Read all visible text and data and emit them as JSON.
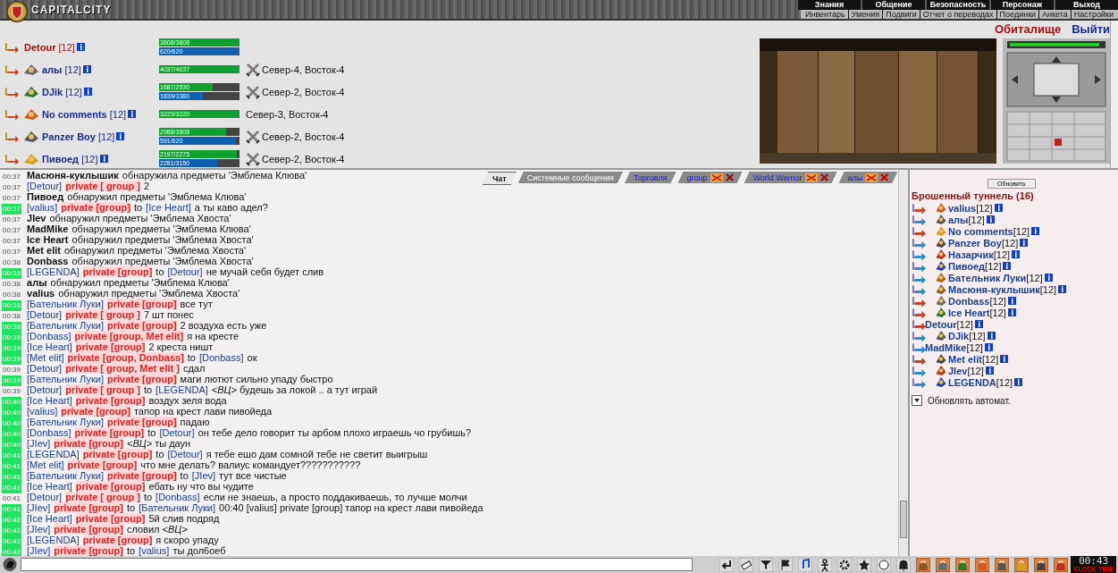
{
  "header": {
    "logo": "CAPITALCITY",
    "menu": [
      "Знания",
      "Общение",
      "Безопасность",
      "Персонаж",
      "Выход"
    ],
    "links": [
      "Инвентарь",
      "Умения",
      "Подвиги",
      "Отчет о переводах",
      "Поединки",
      "Анкета",
      "Настройки"
    ]
  },
  "home_link": "Обиталище",
  "exit_link": "Выйти",
  "party": [
    {
      "name": "Detour",
      "level": "[12]",
      "self": true,
      "emblem": false,
      "hp": {
        "text": "3608/3608",
        "level": 1
      },
      "mp": {
        "text": "620/620",
        "level": 1
      },
      "in_battle": false
    },
    {
      "name": "алы",
      "level": "[12]",
      "self": false,
      "emblem": true,
      "hp": {
        "text": "4037/4037",
        "level": 1
      },
      "in_battle": true,
      "location": "Север-4, Восток-4"
    },
    {
      "name": "DJik",
      "level": "[12]",
      "self": false,
      "emblem": true,
      "hp": {
        "text": "1687/2530",
        "level": 0.67
      },
      "mp": {
        "text": "1839/3380",
        "level": 0.54
      },
      "in_battle": true,
      "location": "Север-2, Восток-4"
    },
    {
      "name": "No comments",
      "level": "[12]",
      "self": false,
      "emblem": true,
      "hp": {
        "text": "3220/3220",
        "level": 1
      },
      "in_battle": false,
      "location": "Север-3, Восток-4"
    },
    {
      "name": "Panzer Boy",
      "level": "[12]",
      "self": false,
      "emblem": true,
      "hp": {
        "text": "2988/3608",
        "level": 0.83
      },
      "mp": {
        "text": "591/620",
        "level": 0.95
      },
      "in_battle": true,
      "location": "Север-2, Восток-4"
    },
    {
      "name": "Пивоед",
      "level": "[12]",
      "self": false,
      "emblem": true,
      "hp": {
        "text": "2197/2275",
        "level": 0.97
      },
      "mp": {
        "text": "2281/3150",
        "level": 0.72
      },
      "in_battle": true,
      "location": "Север-2, Восток-4"
    }
  ],
  "chat": {
    "tabs": [
      {
        "label": "Чат",
        "kind": "main",
        "selected": true,
        "closable": false
      },
      {
        "label": "Системные сообщения",
        "kind": "system",
        "selected": false,
        "closable": false
      },
      {
        "label": "Торговля",
        "kind": "channel",
        "selected": false,
        "closable": false
      },
      {
        "label": "group",
        "kind": "channel",
        "selected": false,
        "closable": true
      },
      {
        "label": "World Warrior",
        "kind": "channel",
        "selected": false,
        "closable": true
      },
      {
        "label": "алы",
        "kind": "channel",
        "selected": false,
        "closable": true
      }
    ],
    "messages": [
      {
        "time": "00:37",
        "highlighted": false,
        "kind": "find",
        "sender": "Масюня-куклышик",
        "text": "обнаружила предметы 'Эмблема Клюва'"
      },
      {
        "time": "00:37",
        "highlighted": false,
        "kind": "private",
        "sender": "[Detour]",
        "channel": "private [ group ]",
        "text": "2"
      },
      {
        "time": "00:37",
        "highlighted": false,
        "kind": "find",
        "sender": "Пивоед",
        "text": "обнаружил предметы 'Эмблема Клюва'"
      },
      {
        "time": "00:37",
        "highlighted": true,
        "kind": "private",
        "sender": "[valius]",
        "channel": "private [group]",
        "prep": "to",
        "target": "[Ice Heart]",
        "text": "а ты каво адел?"
      },
      {
        "time": "00:37",
        "highlighted": false,
        "kind": "find",
        "sender": "JIev",
        "text": "обнаружил предметы 'Эмблема Хвоста'"
      },
      {
        "time": "00:37",
        "highlighted": false,
        "kind": "find",
        "sender": "MadMike",
        "text": "обнаружил предметы 'Эмблема Клюва'"
      },
      {
        "time": "00:37",
        "highlighted": false,
        "kind": "find",
        "sender": "Ice Heart",
        "text": "обнаружил предметы 'Эмблема Хвоста'"
      },
      {
        "time": "00:37",
        "highlighted": false,
        "kind": "find",
        "sender": "Met elit",
        "text": "обнаружил предметы 'Эмблема Хвоста'"
      },
      {
        "time": "00:38",
        "highlighted": false,
        "kind": "find",
        "sender": "Donbass",
        "text": "обнаружил предметы 'Эмблема Хвоста'"
      },
      {
        "time": "00:38",
        "highlighted": true,
        "kind": "private",
        "sender": "[LEGENDA]",
        "channel": "private [group]",
        "prep": "to",
        "target": "[Detour]",
        "text": "не мучай себя будет слив"
      },
      {
        "time": "00:38",
        "highlighted": false,
        "kind": "find",
        "sender": "алы",
        "text": "обнаружил предметы 'Эмблема Клюва'"
      },
      {
        "time": "00:38",
        "highlighted": false,
        "kind": "find",
        "sender": "valius",
        "text": "обнаружил предметы 'Эмблема Хвоста'"
      },
      {
        "time": "00:38",
        "highlighted": true,
        "kind": "private",
        "sender": "[Бательник Луки]",
        "channel": "private [group]",
        "text": "все тут"
      },
      {
        "time": "00:38",
        "highlighted": false,
        "kind": "private",
        "sender": "[Detour]",
        "channel": "private [ group ]",
        "text": "7 шт понес"
      },
      {
        "time": "00:38",
        "highlighted": true,
        "kind": "private",
        "sender": "[Бательник Луки]",
        "channel": "private [group]",
        "text": "2 воздуха есть уже"
      },
      {
        "time": "00:39",
        "highlighted": true,
        "kind": "private",
        "sender": "[Donbass]",
        "channel": "private [group, Met elit]",
        "text": "я на кресте"
      },
      {
        "time": "00:39",
        "highlighted": true,
        "kind": "private",
        "sender": "[Ice Heart]",
        "channel": "private [group]",
        "text": "2 креста ништ"
      },
      {
        "time": "00:39",
        "highlighted": true,
        "kind": "private",
        "sender": "[Met elit]",
        "channel": "private [group, Donbass]",
        "prep": "to",
        "target": "[Donbass]",
        "text": "ок"
      },
      {
        "time": "00:39",
        "highlighted": false,
        "kind": "private",
        "sender": "[Detour]",
        "channel": "private [ group, Met elit ]",
        "text": "сдал"
      },
      {
        "time": "00:39",
        "highlighted": true,
        "kind": "private",
        "sender": "[Бательник Луки]",
        "channel": "private [group]",
        "text": "маги лютют сильно упаду быстро"
      },
      {
        "time": "00:39",
        "highlighted": false,
        "kind": "private",
        "sender": "[Detour]",
        "channel": "private [ group ]",
        "prep": "to",
        "target": "[LEGENDA]",
        "text": "*<ВЦ>* будешь за локой .. а тут играй"
      },
      {
        "time": "00:40",
        "highlighted": true,
        "kind": "private",
        "sender": "[Ice Heart]",
        "channel": "private [group]",
        "text": "воздух зеля вода"
      },
      {
        "time": "00:40",
        "highlighted": true,
        "kind": "private",
        "sender": "[valius]",
        "channel": "private [group]",
        "text": "тапор на крест лави пивойеда"
      },
      {
        "time": "00:40",
        "highlighted": true,
        "kind": "private",
        "sender": "[Бательник Луки]",
        "channel": "private [group]",
        "text": "падаю"
      },
      {
        "time": "00:40",
        "highlighted": true,
        "kind": "private",
        "sender": "[Donbass]",
        "channel": "private [group]",
        "prep": "to",
        "target": "[Detour]",
        "text": "он тебе дело говорит ты арбом плохо играешь чо грубишь?"
      },
      {
        "time": "00:40",
        "highlighted": true,
        "kind": "private",
        "sender": "[JIev]",
        "channel": "private [group]",
        "text": "*<ВЦ>* ты даун"
      },
      {
        "time": "00:41",
        "highlighted": true,
        "kind": "private",
        "sender": "[LEGENDA]",
        "channel": "private [group]",
        "prep": "to",
        "target": "[Detour]",
        "text": "я тебе ешо дам сомной тебе не светит выигрыш"
      },
      {
        "time": "00:41",
        "highlighted": true,
        "kind": "private",
        "sender": "[Met elit]",
        "channel": "private [group]",
        "text": "что мне делать? валиус командует???????????"
      },
      {
        "time": "00:41",
        "highlighted": true,
        "kind": "private",
        "sender": "[Бательник Луки]",
        "channel": "private [group]",
        "prep": "to",
        "target": "[JIev]",
        "text": "тут все чистые"
      },
      {
        "time": "00:41",
        "highlighted": true,
        "kind": "private",
        "sender": "[Ice Heart]",
        "channel": "private [group]",
        "text": "ебать ну что вы чудите"
      },
      {
        "time": "00:41",
        "highlighted": false,
        "kind": "private",
        "sender": "[Detour]",
        "channel": "private [ group ]",
        "prep": "to",
        "target": "[Donbass]",
        "text": "если не знаешь, а просто поддакиваешь, то лучше молчи"
      },
      {
        "time": "00:41",
        "highlighted": true,
        "kind": "private",
        "sender": "[JIev]",
        "channel": "private [group]",
        "prep": "to",
        "target": "[Бательник Луки]",
        "text": "00:40 [valius] private [group] тапор на крест лави пивойеда"
      },
      {
        "time": "00:42",
        "highlighted": true,
        "kind": "private",
        "sender": "[Ice Heart]",
        "channel": "private [group]",
        "text": "5й слив подряд"
      },
      {
        "time": "00:42",
        "highlighted": true,
        "kind": "private",
        "sender": "[JIev]",
        "channel": "private [group]",
        "text": "словил *<ВЦ>*"
      },
      {
        "time": "00:42",
        "highlighted": true,
        "kind": "private",
        "sender": "[LEGENDA]",
        "channel": "private [group]",
        "text": "я скоро упаду"
      },
      {
        "time": "00:42",
        "highlighted": true,
        "kind": "private",
        "sender": "[JIev]",
        "channel": "private [group]",
        "prep": "to",
        "target": "[valius]",
        "text": "ты дол6оеб"
      }
    ]
  },
  "room": {
    "refresh_button": "Обновить",
    "title": "Брошенный туннель (16)",
    "players": [
      {
        "name": "valius",
        "level": "[12]",
        "color": "#c8401c",
        "emblem": true
      },
      {
        "name": "алы",
        "level": "[12]",
        "color": "#2a8cc8",
        "emblem": true
      },
      {
        "name": "No comments",
        "level": "[12]",
        "color": "#c8401c",
        "emblem": true
      },
      {
        "name": "Panzer Boy",
        "level": "[12]",
        "color": "#2a8cc8",
        "emblem": true
      },
      {
        "name": "Назарчик",
        "level": "[12]",
        "color": "#2a8cc8",
        "emblem": true
      },
      {
        "name": "Пивоед",
        "level": "[12]",
        "color": "#2a8cc8",
        "emblem": true
      },
      {
        "name": "Бательник Луки",
        "level": "[12]",
        "color": "#2a8cc8",
        "emblem": true
      },
      {
        "name": "Масюня-куклышик",
        "level": "[12]",
        "color": "#2a8cc8",
        "emblem": true
      },
      {
        "name": "Donbass",
        "level": "[12]",
        "color": "#c8401c",
        "emblem": true
      },
      {
        "name": "Ice Heart",
        "level": "[12]",
        "color": "#c8401c",
        "emblem": true
      },
      {
        "name": "Detour",
        "level": "[12]",
        "color": "#c8401c",
        "emblem": false
      },
      {
        "name": "DJik",
        "level": "[12]",
        "color": "#2a8cc8",
        "emblem": true
      },
      {
        "name": "MadMike",
        "level": "[12]",
        "color": "#2a8cc8",
        "emblem": false
      },
      {
        "name": "Met elit",
        "level": "[12]",
        "color": "#c8401c",
        "emblem": true
      },
      {
        "name": "JIev",
        "level": "[12]",
        "color": "#2a8cc8",
        "emblem": true
      },
      {
        "name": "LEGENDA",
        "level": "[12]",
        "color": "#2a8cc8",
        "emblem": true
      }
    ],
    "auto_refresh": {
      "label": "Обновлять автомат.",
      "checked": true
    }
  },
  "clock": {
    "time": "00:43",
    "labels": [
      "CLOCK",
      "TIME"
    ]
  }
}
